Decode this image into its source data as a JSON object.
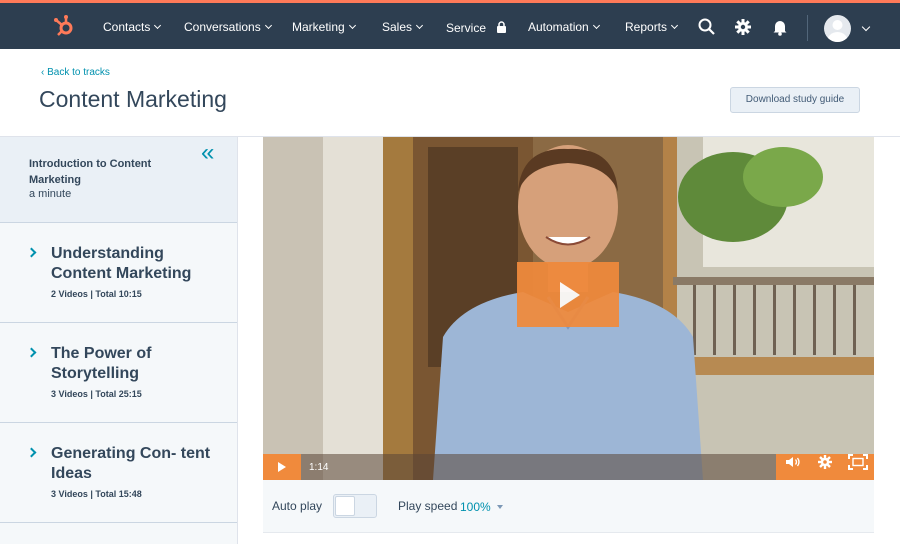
{
  "nav": {
    "items": [
      {
        "label": "Contacts",
        "dropdown": true
      },
      {
        "label": "Conversations",
        "dropdown": true
      },
      {
        "label": "Marketing",
        "dropdown": true
      },
      {
        "label": "Sales",
        "dropdown": true
      },
      {
        "label": "Service",
        "dropdown": false,
        "icon": "lock-icon"
      },
      {
        "label": "Automation",
        "dropdown": true
      },
      {
        "label": "Reports",
        "dropdown": true
      }
    ],
    "icons": [
      "sprocket-logo-icon",
      "search-icon",
      "gear-icon",
      "bell-icon",
      "avatar"
    ],
    "accent": "#ff7a59",
    "background": "#2d3e50"
  },
  "header": {
    "back_link": "‹ Back to tracks",
    "title": "Content Marketing",
    "download_label": "Download study guide"
  },
  "sidebar": {
    "current": {
      "title": "Introduction to Content Marketing",
      "duration": "a minute"
    },
    "modules": [
      {
        "title": "Understanding Content Marketing",
        "meta": "2 Videos | Total 10:15"
      },
      {
        "title": "The Power of Storytelling",
        "meta": "3 Videos | Total 25:15"
      },
      {
        "title": "Generating Con- tent Ideas",
        "meta": "3 Videos | Total 15:48"
      }
    ]
  },
  "video": {
    "duration": "1:14",
    "accent": "#f08a3c"
  },
  "settings": {
    "autoplay_label": "Auto play",
    "autoplay_on": false,
    "speed_label": "Play speed",
    "speed_value": "100%"
  },
  "colors": {
    "link": "#0091ae",
    "text": "#33475b",
    "sidebar_bg": "#f5f8fa"
  }
}
